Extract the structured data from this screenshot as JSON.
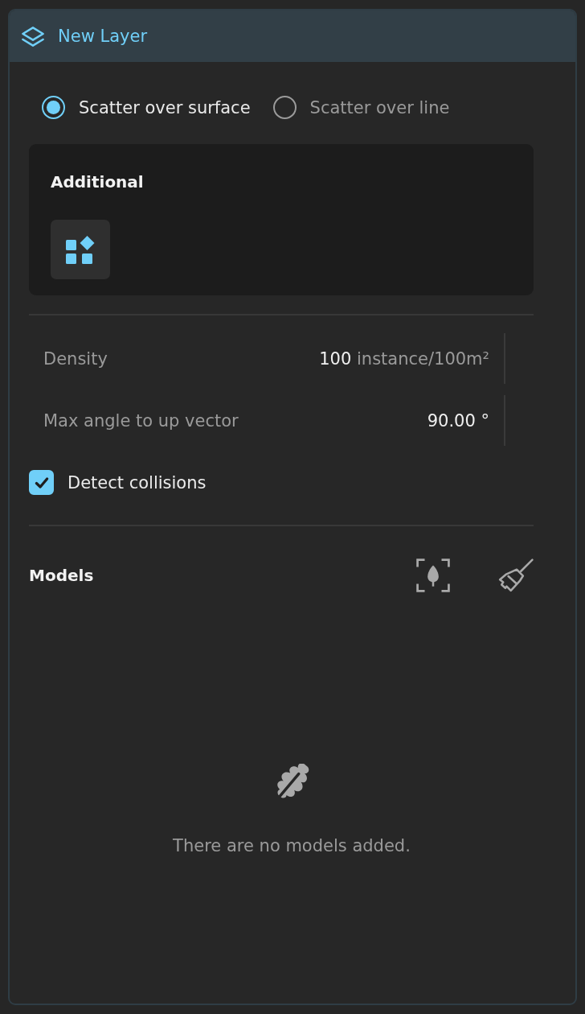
{
  "panel": {
    "title": "New Layer"
  },
  "scatter_modes": [
    {
      "label": "Scatter over surface",
      "selected": true
    },
    {
      "label": "Scatter over line",
      "selected": false
    }
  ],
  "additional": {
    "title": "Additional"
  },
  "fields": [
    {
      "label": "Density",
      "value": "100",
      "unit": "instance/100m²"
    },
    {
      "label": "Max angle to up vector",
      "value": "90.00 °"
    }
  ],
  "detect_collisions": {
    "label": "Detect collisions",
    "checked": true
  },
  "models": {
    "title": "Models",
    "empty_message": "There are no models added."
  }
}
